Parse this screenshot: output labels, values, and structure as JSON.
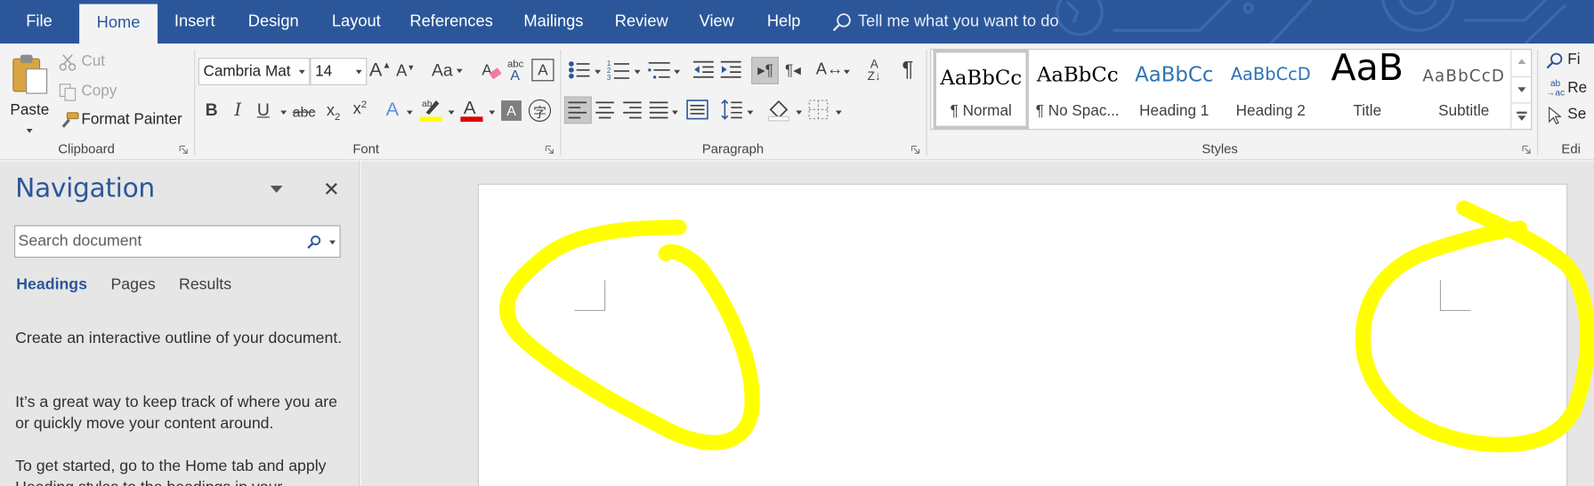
{
  "tabs": [
    {
      "label": "File",
      "active": false
    },
    {
      "label": "Home",
      "active": true
    },
    {
      "label": "Insert",
      "active": false
    },
    {
      "label": "Design",
      "active": false
    },
    {
      "label": "Layout",
      "active": false
    },
    {
      "label": "References",
      "active": false
    },
    {
      "label": "Mailings",
      "active": false
    },
    {
      "label": "Review",
      "active": false
    },
    {
      "label": "View",
      "active": false
    },
    {
      "label": "Help",
      "active": false
    }
  ],
  "tell_me": {
    "text": "Tell me what you want to do",
    "icon": "lightbulb-search-icon"
  },
  "clipboard": {
    "paste_label": "Paste",
    "cut_label": "Cut",
    "copy_label": "Copy",
    "format_painter_label": "Format Painter",
    "group_label": "Clipboard"
  },
  "font": {
    "font_name": "Cambria Mat",
    "font_size": "14",
    "group_label": "Font",
    "change_case_label": "Aa",
    "highlight_color": "#ffff00",
    "font_color": "#e00000"
  },
  "paragraph": {
    "group_label": "Paragraph"
  },
  "styles": {
    "group_label": "Styles",
    "items": [
      {
        "preview": "AaBbCc",
        "name": "¶ Normal",
        "selected": true
      },
      {
        "preview": "AaBbCc",
        "name": "¶ No Spac...",
        "selected": false
      },
      {
        "preview": "AaBbCc",
        "name": "Heading 1",
        "selected": false
      },
      {
        "preview": "AaBbCcD",
        "name": "Heading 2",
        "selected": false
      },
      {
        "preview": "AaB",
        "name": "Title",
        "selected": false
      },
      {
        "preview": "AaBbCcD",
        "name": "Subtitle",
        "selected": false
      }
    ]
  },
  "editing": {
    "find_label": "Fi",
    "replace_label": "Re",
    "select_label": "Se",
    "group_label": "Edi"
  },
  "navigation": {
    "title": "Navigation",
    "search_placeholder": "Search document",
    "tabs": [
      {
        "label": "Headings",
        "active": true
      },
      {
        "label": "Pages",
        "active": false
      },
      {
        "label": "Results",
        "active": false
      }
    ],
    "paragraphs": [
      "Create an interactive outline of your document.",
      "It’s a great way to keep track of where you are or quickly move your content around.",
      "To get started, go to the Home tab and apply Heading styles to the headings in your"
    ]
  },
  "colors": {
    "accent": "#2b579a",
    "annotation": "#ffff00"
  }
}
